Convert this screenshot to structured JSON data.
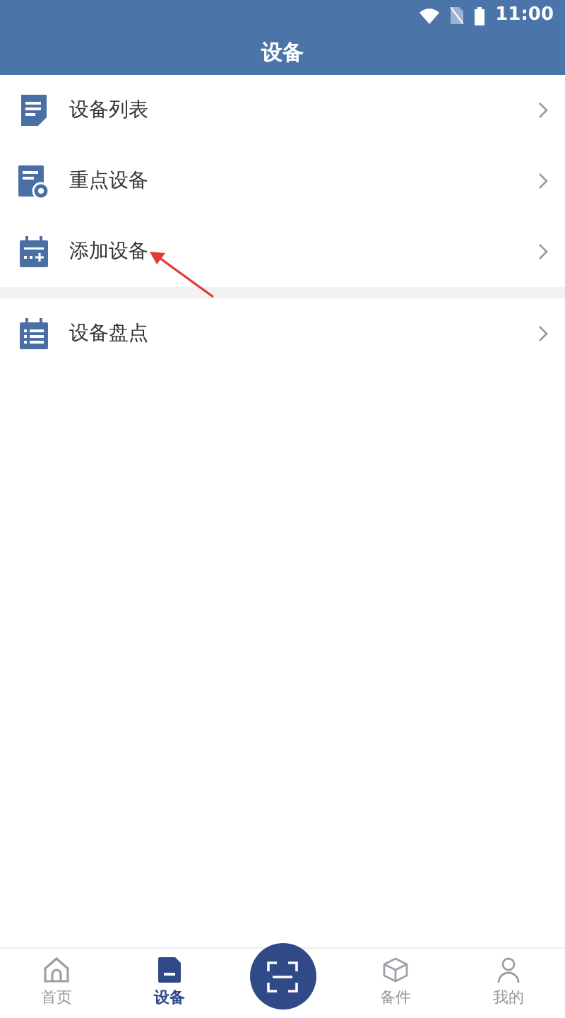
{
  "status_bar": {
    "time": "11:00"
  },
  "header": {
    "title": "设备"
  },
  "menu_groups": [
    [
      {
        "label": "设备列表",
        "kind": "list"
      },
      {
        "label": "重点设备",
        "kind": "key"
      },
      {
        "label": "添加设备",
        "kind": "add"
      }
    ],
    [
      {
        "label": "设备盘点",
        "kind": "inventory"
      }
    ]
  ],
  "tabs": [
    {
      "label": "首页",
      "kind": "home",
      "selected": false
    },
    {
      "label": "设备",
      "kind": "device",
      "selected": true
    },
    {
      "kind": "scan",
      "selected": false
    },
    {
      "label": "备件",
      "kind": "parts",
      "selected": false
    },
    {
      "label": "我的",
      "kind": "user",
      "selected": false
    }
  ]
}
